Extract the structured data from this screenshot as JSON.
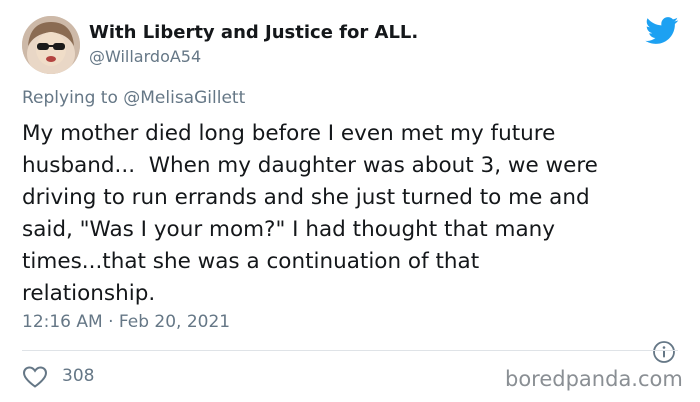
{
  "author": {
    "display_name": "With Liberty and Justice for ALL.",
    "handle": "@WillardoA54"
  },
  "reply": {
    "prefix": "Replying to",
    "mention": "@MelisaGillett"
  },
  "tweet": {
    "text": "My mother died long before I even met my future\nhusband...  When my daughter was about 3, we were\ndriving to run errands and she just turned to me and\nsaid, \"Was I your mom?\" I had thought that many\ntimes...that she was a continuation of that\nrelationship.",
    "timestamp": "12:16 AM · Feb 20, 2021"
  },
  "actions": {
    "like_count": "308"
  },
  "watermark": "boredpanda.com",
  "colors": {
    "twitter_blue": "#1da1f2",
    "secondary_text": "#657786",
    "primary_text": "#14171a"
  },
  "icons": [
    "avatar",
    "twitter-logo-icon",
    "info-icon",
    "heart-icon"
  ]
}
